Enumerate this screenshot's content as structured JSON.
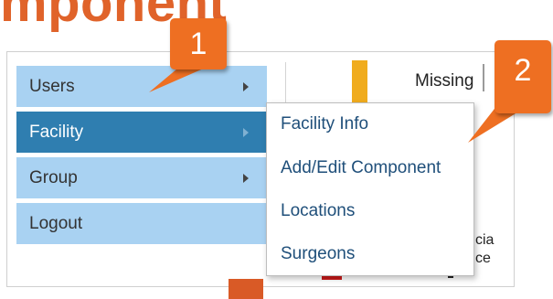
{
  "heading_fragment": "mponent",
  "menu": {
    "items": [
      {
        "label": "Users"
      },
      {
        "label": "Facility"
      },
      {
        "label": "Group"
      },
      {
        "label": "Logout"
      }
    ],
    "active_index": 1
  },
  "submenu": {
    "items": [
      {
        "label": "Facility Info"
      },
      {
        "label": "Add/Edit Component"
      },
      {
        "label": "Locations"
      },
      {
        "label": "Surgeons"
      }
    ]
  },
  "background": {
    "missing_label": "Missing",
    "partial_text_1": "cia",
    "partial_text_2": "ce"
  },
  "callouts": {
    "step_1": "1",
    "step_2": "2"
  },
  "colors": {
    "callout": "#ee6f22",
    "menu_item_bg": "#a9d2f2",
    "menu_item_active_bg": "#2f7eb0",
    "submenu_text": "#1f4f7a",
    "heading": "#e0632a"
  },
  "icons": {
    "submenu_indicator": "chevron-right-icon"
  }
}
